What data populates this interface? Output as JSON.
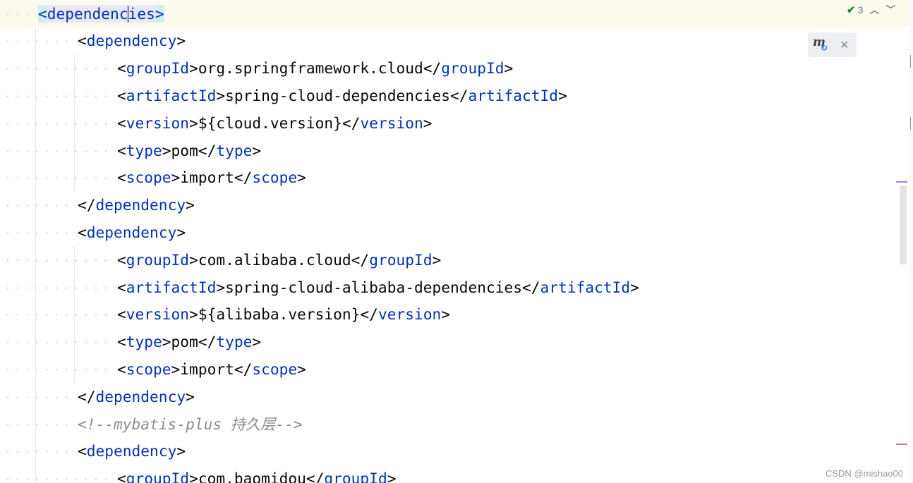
{
  "editor": {
    "lines": [
      {
        "indent": 1,
        "current": true,
        "tokens": [
          {
            "t": "<",
            "c": "tagstrip brace-hl"
          },
          {
            "t": "dependenc",
            "c": "tag tag-hl"
          },
          {
            "t": "|",
            "c": "caret"
          },
          {
            "t": "ies",
            "c": "tag tag-hl"
          },
          {
            "t": ">",
            "c": "tagstrip brace-hl"
          }
        ]
      },
      {
        "indent": 2,
        "tokens": [
          {
            "t": "<",
            "c": ""
          },
          {
            "t": "dependency",
            "c": "tag"
          },
          {
            "t": ">",
            "c": ""
          }
        ]
      },
      {
        "indent": 3,
        "tokens": [
          {
            "t": "<",
            "c": ""
          },
          {
            "t": "groupId",
            "c": "tag"
          },
          {
            "t": ">org.springframework.cloud</",
            "c": ""
          },
          {
            "t": "groupId",
            "c": "tag"
          },
          {
            "t": ">",
            "c": ""
          }
        ]
      },
      {
        "indent": 3,
        "tokens": [
          {
            "t": "<",
            "c": ""
          },
          {
            "t": "artifactId",
            "c": "tag"
          },
          {
            "t": ">spring-cloud-dependencies</",
            "c": ""
          },
          {
            "t": "artifactId",
            "c": "tag"
          },
          {
            "t": ">",
            "c": ""
          }
        ]
      },
      {
        "indent": 3,
        "tokens": [
          {
            "t": "<",
            "c": ""
          },
          {
            "t": "version",
            "c": "tag"
          },
          {
            "t": ">${cloud.version}</",
            "c": ""
          },
          {
            "t": "version",
            "c": "tag"
          },
          {
            "t": ">",
            "c": ""
          }
        ]
      },
      {
        "indent": 3,
        "tokens": [
          {
            "t": "<",
            "c": ""
          },
          {
            "t": "type",
            "c": "tag"
          },
          {
            "t": ">pom</",
            "c": ""
          },
          {
            "t": "type",
            "c": "tag"
          },
          {
            "t": ">",
            "c": ""
          }
        ]
      },
      {
        "indent": 3,
        "tokens": [
          {
            "t": "<",
            "c": ""
          },
          {
            "t": "scope",
            "c": "tag"
          },
          {
            "t": ">import</",
            "c": ""
          },
          {
            "t": "scope",
            "c": "tag"
          },
          {
            "t": ">",
            "c": ""
          }
        ]
      },
      {
        "indent": 2,
        "tokens": [
          {
            "t": "</",
            "c": ""
          },
          {
            "t": "dependency",
            "c": "tag"
          },
          {
            "t": ">",
            "c": ""
          }
        ]
      },
      {
        "indent": 2,
        "tokens": [
          {
            "t": "<",
            "c": ""
          },
          {
            "t": "dependency",
            "c": "tag"
          },
          {
            "t": ">",
            "c": ""
          }
        ]
      },
      {
        "indent": 3,
        "tokens": [
          {
            "t": "<",
            "c": ""
          },
          {
            "t": "groupId",
            "c": "tag"
          },
          {
            "t": ">com.alibaba.cloud</",
            "c": ""
          },
          {
            "t": "groupId",
            "c": "tag"
          },
          {
            "t": ">",
            "c": ""
          }
        ]
      },
      {
        "indent": 3,
        "tokens": [
          {
            "t": "<",
            "c": ""
          },
          {
            "t": "artifactId",
            "c": "tag"
          },
          {
            "t": ">spring-cloud-alibaba-dependencies</",
            "c": ""
          },
          {
            "t": "artifactId",
            "c": "tag"
          },
          {
            "t": ">",
            "c": ""
          }
        ]
      },
      {
        "indent": 3,
        "tokens": [
          {
            "t": "<",
            "c": ""
          },
          {
            "t": "version",
            "c": "tag"
          },
          {
            "t": ">${alibaba.version}</",
            "c": ""
          },
          {
            "t": "version",
            "c": "tag"
          },
          {
            "t": ">",
            "c": ""
          }
        ]
      },
      {
        "indent": 3,
        "tokens": [
          {
            "t": "<",
            "c": ""
          },
          {
            "t": "type",
            "c": "tag"
          },
          {
            "t": ">pom</",
            "c": ""
          },
          {
            "t": "type",
            "c": "tag"
          },
          {
            "t": ">",
            "c": ""
          }
        ]
      },
      {
        "indent": 3,
        "tokens": [
          {
            "t": "<",
            "c": ""
          },
          {
            "t": "scope",
            "c": "tag"
          },
          {
            "t": ">import</",
            "c": ""
          },
          {
            "t": "scope",
            "c": "tag"
          },
          {
            "t": ">",
            "c": ""
          }
        ]
      },
      {
        "indent": 2,
        "tokens": [
          {
            "t": "</",
            "c": ""
          },
          {
            "t": "dependency",
            "c": "tag"
          },
          {
            "t": ">",
            "c": ""
          }
        ]
      },
      {
        "indent": 2,
        "tokens": [
          {
            "t": "<!--mybatis-plus 持久层-->",
            "c": "comment"
          }
        ]
      },
      {
        "indent": 2,
        "tokens": [
          {
            "t": "<",
            "c": ""
          },
          {
            "t": "dependency",
            "c": "tag"
          },
          {
            "t": ">",
            "c": ""
          }
        ]
      },
      {
        "indent": 3,
        "tokens": [
          {
            "t": "<",
            "c": ""
          },
          {
            "t": "groupId",
            "c": "tag"
          },
          {
            "t": ">com.baomidou</",
            "c": ""
          },
          {
            "t": "groupId",
            "c": "tag"
          },
          {
            "t": ">",
            "c": ""
          }
        ]
      }
    ]
  },
  "inspection": {
    "icon": "check-icon",
    "count": "3",
    "prev_icon": "chevron-up-icon",
    "next_icon": "chevron-down-icon"
  },
  "maven_popup": {
    "icon": "maven-reload-icon",
    "close_icon": "close-icon"
  },
  "watermark": "CSDN @mishao00",
  "colors": {
    "tag": "#0033b3",
    "text": "#080808",
    "comment": "#8c8c8c",
    "current_line": "#fcfaed",
    "brace_highlight": "#d2eef0",
    "marker": "#b97fe0"
  }
}
